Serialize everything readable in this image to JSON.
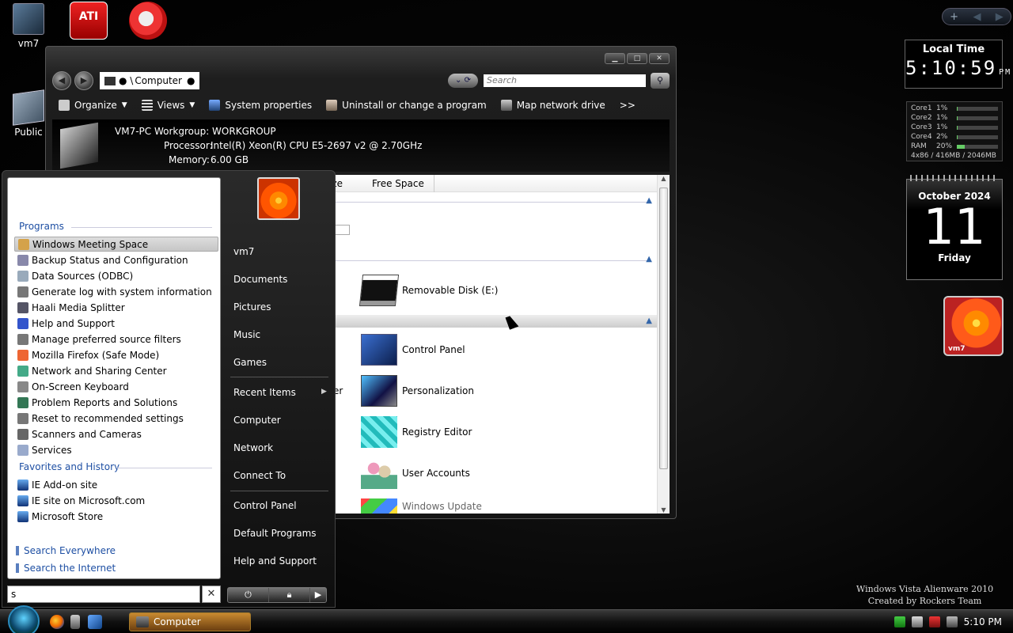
{
  "desktop": {
    "icons": [
      {
        "label": "vm7",
        "icon": "computer-icon"
      },
      {
        "label": "Public",
        "icon": "public-folder-icon"
      }
    ],
    "top_icons": [
      "ati-radeon-icon",
      "ccleaner-icon"
    ]
  },
  "explorer": {
    "address": "Computer",
    "search_placeholder": "Search",
    "toolbar": {
      "organize": "Organize",
      "views": "Views",
      "system_properties": "System properties",
      "uninstall": "Uninstall or change a program",
      "map_drive": "Map network drive",
      "more": ">>"
    },
    "details": {
      "name_line": "VM7-PC  Workgroup: WORKGROUP",
      "processor_label": "Processor:",
      "processor_value": "Intel(R) Xeon(R) CPU E5-2697 v2 @ 2.70GHz",
      "memory_label": "Memory:",
      "memory_value": "6.00 GB"
    },
    "columns": {
      "size_partial": "ize",
      "free_space": "Free Space"
    },
    "partial_text": "er",
    "items": [
      {
        "label": "Removable Disk (E:)",
        "icon": "removable-disk-icon"
      },
      {
        "label": "Control Panel",
        "icon": "control-panel-icon"
      },
      {
        "label": "Personalization",
        "icon": "personalization-icon"
      },
      {
        "label": "Registry Editor",
        "icon": "registry-editor-icon"
      },
      {
        "label": "User Accounts",
        "icon": "user-accounts-icon"
      },
      {
        "label": "Windows Update",
        "icon": "windows-update-icon"
      }
    ]
  },
  "startmenu": {
    "programs_title": "Programs",
    "programs": [
      "Windows Meeting Space",
      "Backup Status and Configuration",
      "Data Sources (ODBC)",
      "Generate log with system information",
      "Haali Media Splitter",
      "Help and Support",
      "Manage preferred source filters",
      "Mozilla Firefox (Safe Mode)",
      "Network and Sharing Center",
      "On-Screen Keyboard",
      "Problem Reports and Solutions",
      "Reset to recommended settings",
      "Scanners and Cameras",
      "Services"
    ],
    "favorites_title": "Favorites and History",
    "favorites": [
      "IE Add-on site",
      "IE site on Microsoft.com",
      "Microsoft Store"
    ],
    "search_everywhere": "Search Everywhere",
    "search_internet": "Search the Internet",
    "search_value": "s",
    "clear_symbol": "✕",
    "right_items": {
      "user": "vm7",
      "documents": "Documents",
      "pictures": "Pictures",
      "music": "Music",
      "games": "Games",
      "recent": "Recent Items",
      "computer": "Computer",
      "network": "Network",
      "connect": "Connect To",
      "control_panel": "Control Panel",
      "default_programs": "Default Programs",
      "help": "Help and Support"
    }
  },
  "taskbar": {
    "task_label": "Computer",
    "time": "5:10 PM"
  },
  "gadgets": {
    "clock_title": "Local Time",
    "clock_time": "5:10:59",
    "clock_ampm": "PM",
    "cpu": [
      {
        "name": "Core1",
        "pct": "1%",
        "level": 0.01
      },
      {
        "name": "Core2",
        "pct": "1%",
        "level": 0.01
      },
      {
        "name": "Core3",
        "pct": "1%",
        "level": 0.01
      },
      {
        "name": "Core4",
        "pct": "2%",
        "level": 0.02
      },
      {
        "name": "RAM",
        "pct": "20%",
        "level": 0.2
      }
    ],
    "cpu_footer": "4x86 / 416MB / 2046MB",
    "calendar_month": "October 2024",
    "calendar_day": "11",
    "calendar_weekday": "Friday",
    "user_tile_label": "vm7"
  },
  "watermark": {
    "line1": "Windows Vista Alienware 2010",
    "line2": "Created by Rockers Team"
  }
}
